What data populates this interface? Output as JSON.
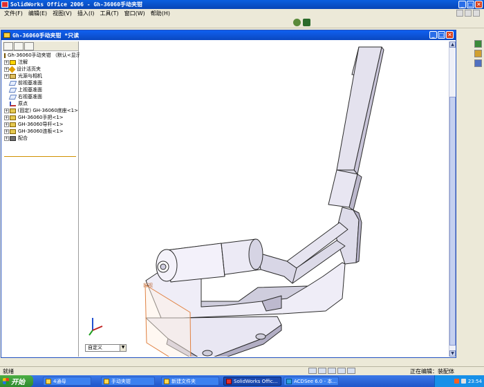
{
  "app": {
    "title": "SolidWorks Office 2006 - Gh-36060手动夹钳",
    "minimize": "_",
    "restore": "□",
    "close": "✕"
  },
  "menu": [
    "文件(F)",
    "编辑(E)",
    "视图(V)",
    "插入(I)",
    "工具(T)",
    "窗口(W)",
    "帮助(H)"
  ],
  "document": {
    "title": "Gh-36060手动夹钳 *只读",
    "minimize": "_",
    "restore": "□",
    "close": "✕"
  },
  "feature_tree": {
    "root": "Gh-36060手动夹钳 （默认<显示",
    "items": [
      {
        "label": "注解",
        "icon": "annotation-icon",
        "expandable": true
      },
      {
        "label": "设计活页夹",
        "icon": "design-binder-icon",
        "expandable": true
      },
      {
        "label": "光源与相机",
        "icon": "lights-cameras-icon",
        "expandable": true
      },
      {
        "label": "前视基准面",
        "icon": "plane-icon",
        "expandable": false
      },
      {
        "label": "上视基准面",
        "icon": "plane-icon",
        "expandable": false
      },
      {
        "label": "右视基准面",
        "icon": "plane-icon",
        "expandable": false
      },
      {
        "label": "原点",
        "icon": "origin-icon",
        "expandable": false
      },
      {
        "label": "(固定) GH-36060底座<1>",
        "icon": "part-icon",
        "expandable": true
      },
      {
        "label": "GH-36060手把<1>",
        "icon": "part-icon",
        "expandable": true
      },
      {
        "label": "GH-36060导杆<1>",
        "icon": "part-icon",
        "expandable": true
      },
      {
        "label": "GH-36060连板<1>",
        "icon": "part-icon",
        "expandable": true
      },
      {
        "label": "配合",
        "icon": "mates-icon",
        "expandable": true
      }
    ]
  },
  "graphics": {
    "configuration": "自定义",
    "plane_label": "前视"
  },
  "statusbar": {
    "ready": "就绪",
    "editing": "正在编辑：装配体"
  },
  "taskbar": {
    "start": "开始",
    "tasks": [
      "4通母",
      "手动夹钳",
      "新建文件夹",
      "SolidWorks Offic...",
      "ACDSee 6.0 - 本..."
    ],
    "clock": "23:54"
  }
}
